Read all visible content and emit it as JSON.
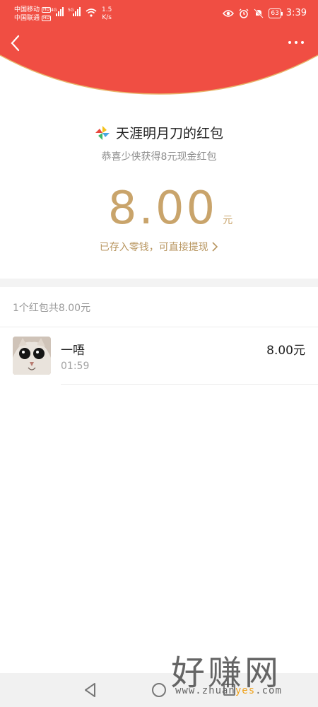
{
  "status_bar": {
    "carrier_1": "中国移动",
    "carrier_2": "中国联通",
    "hd_badge": "HD",
    "net_1": "4G",
    "net_2": "5G",
    "speed_value": "1.5",
    "speed_unit": "K/s",
    "battery": "63",
    "time": "3:39"
  },
  "header": {
    "back_icon": "chevron-left-icon",
    "more_icon": "more-dots-icon",
    "accent_color": "#f04e43"
  },
  "packet": {
    "sender_title": "天涯明月刀的红包",
    "greeting": "恭喜少侠获得8元现金红包",
    "amount": "8.00",
    "amount_unit": "元",
    "saved_link": "已存入零钱，可直接提现",
    "gold_color": "#c9a46b"
  },
  "records": {
    "summary": "1个红包共8.00元",
    "items": [
      {
        "name": "一唔",
        "time": "01:59",
        "amount": "8.00元"
      }
    ]
  },
  "watermark": {
    "title": "好赚网",
    "url_prefix": "www.zhuan",
    "url_highlight": "yes",
    "url_suffix": ".com"
  }
}
